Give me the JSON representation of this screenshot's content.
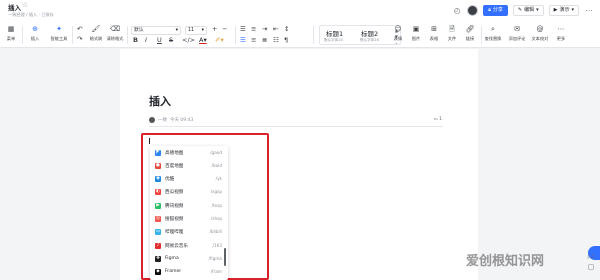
{
  "document": {
    "title": "插入",
    "breadcrumb": "一致经理 / 插入 · 已保存",
    "meta_author": "一致",
    "meta_time": "今天 09:43",
    "comment_count": "1"
  },
  "top_actions": {
    "share": "分享",
    "edit": "编辑",
    "present": "演示"
  },
  "toolbar": {
    "menu": "菜单",
    "insert": "插入",
    "smart_tools": "智能工具",
    "format_painter": "格式刷",
    "clear_format": "清除格式",
    "font": "默认",
    "font_size": "11",
    "bold": "B",
    "italic": "I",
    "underline": "U",
    "strike": "S",
    "heading1": "标题1",
    "heading1_sub": "默认字体20",
    "heading2": "标题2",
    "heading2_sub": "默认字体16",
    "emoji": "表情",
    "image": "图片",
    "table": "表格",
    "file": "文件",
    "link": "链接",
    "find_replace": "查找替换",
    "add_comment": "添加评论",
    "text_review": "文本校对",
    "more": "更多"
  },
  "dropdown": {
    "items": [
      {
        "name": "高德地图",
        "short": "/gaod",
        "color": "#2f86f6",
        "icon": "map-icon"
      },
      {
        "name": "百度地图",
        "short": "/baid",
        "color": "#e84a3c",
        "icon": "pin-icon"
      },
      {
        "name": "优酷",
        "short": "/yk",
        "color": "#1e88e5",
        "icon": "youku-icon"
      },
      {
        "name": "西瓜视频",
        "short": "/xgsp",
        "color": "#f0413a",
        "icon": "watermelon-icon"
      },
      {
        "name": "腾讯视频",
        "short": "/txsp",
        "color": "#2bbf6a",
        "icon": "play-icon"
      },
      {
        "name": "搜狐视频",
        "short": "/shsp",
        "color": "#f2564e",
        "icon": "sohu-icon"
      },
      {
        "name": "哔哩哔哩",
        "short": "/blibili",
        "color": "#3ab4e8",
        "icon": "tv-icon"
      },
      {
        "name": "网易云音乐",
        "short": "/163",
        "color": "#e02f2f",
        "icon": "music-icon"
      },
      {
        "name": "Figma",
        "short": "/figma",
        "color": "#1e1e1e",
        "icon": "figma-icon"
      },
      {
        "name": "Framer",
        "short": "/fram",
        "color": "#0a0a0a",
        "icon": "framer-icon"
      }
    ]
  },
  "watermark": "爱创根知识网"
}
